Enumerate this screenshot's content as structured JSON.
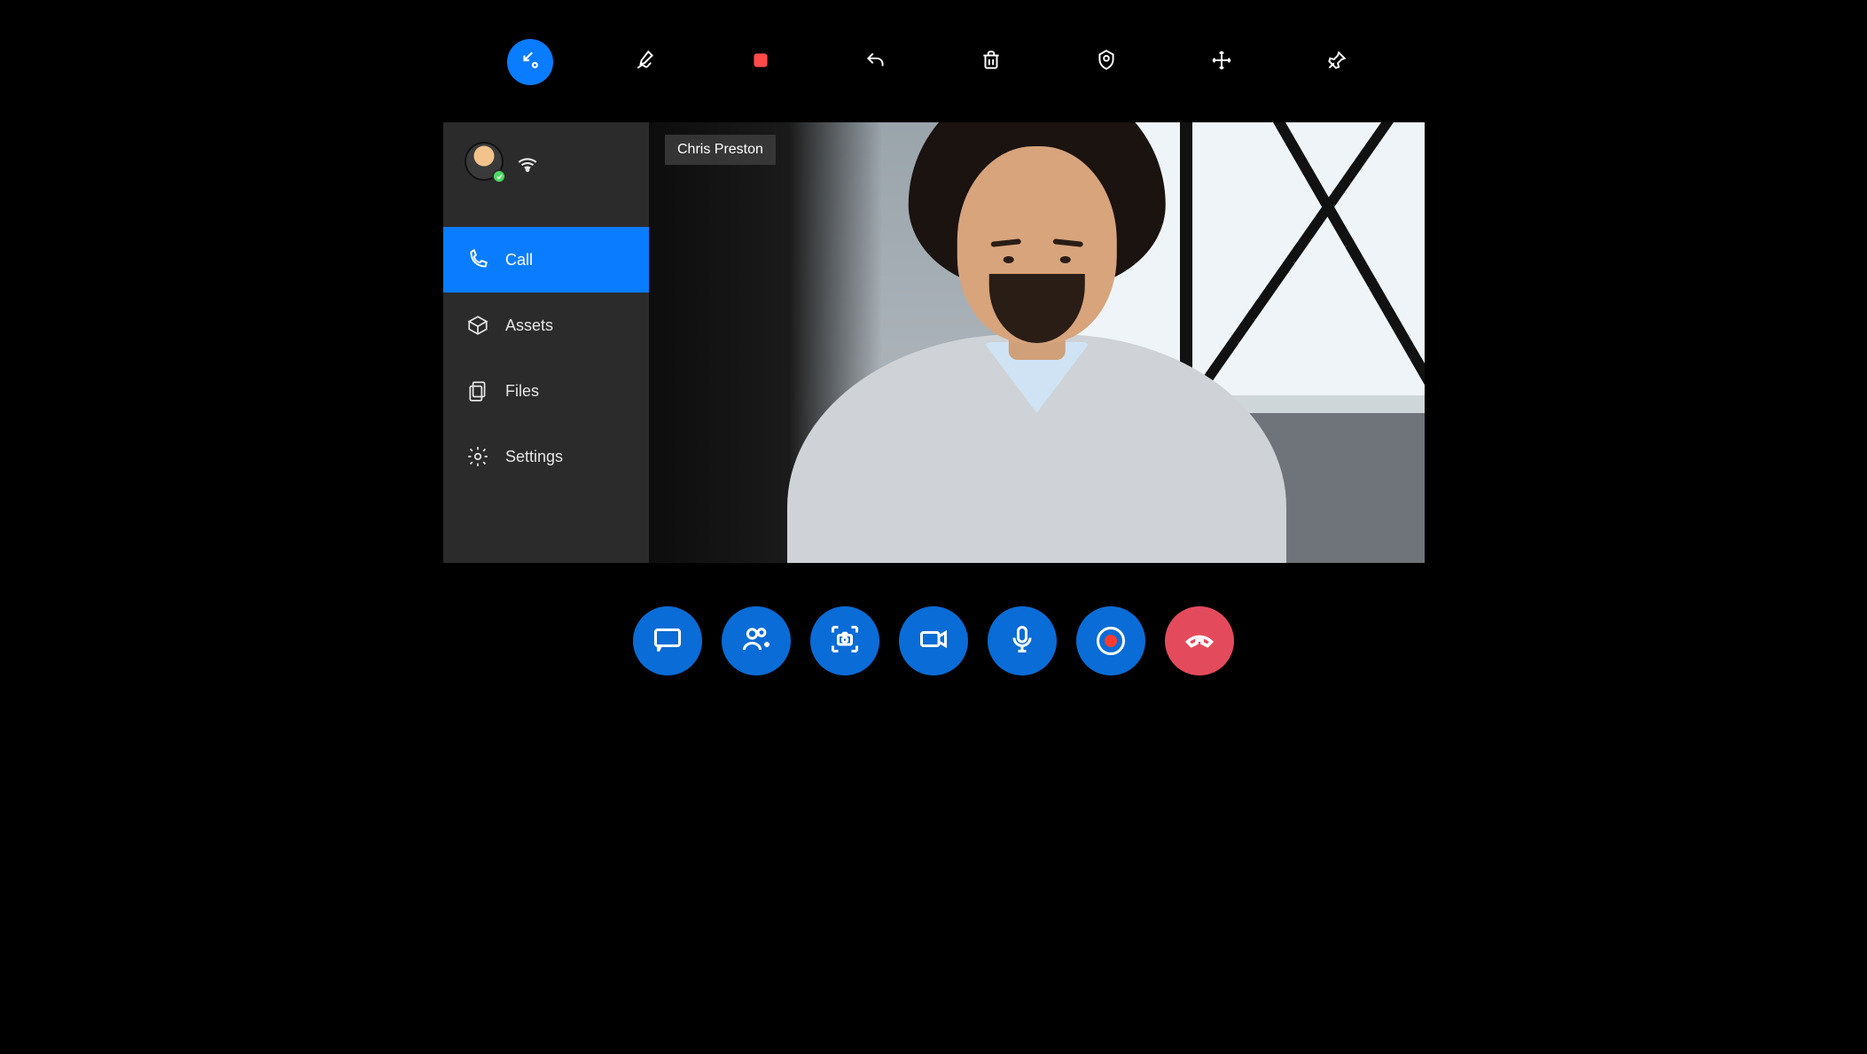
{
  "participant": {
    "name": "Chris Preston"
  },
  "sidebar": {
    "items": [
      {
        "label": "Call"
      },
      {
        "label": "Assets"
      },
      {
        "label": "Files"
      },
      {
        "label": "Settings"
      }
    ]
  },
  "topToolbar": {
    "icons": [
      "collapse",
      "ink",
      "stop",
      "undo",
      "delete",
      "place",
      "move",
      "pin"
    ]
  },
  "callBar": {
    "icons": [
      "chat",
      "add-participant",
      "capture",
      "video",
      "microphone",
      "record",
      "end-call"
    ]
  },
  "colors": {
    "accent": "#0a7cff",
    "accentDark": "#0a6cd6",
    "danger": "#e34b5c",
    "sidebar": "#2b2b2b"
  }
}
